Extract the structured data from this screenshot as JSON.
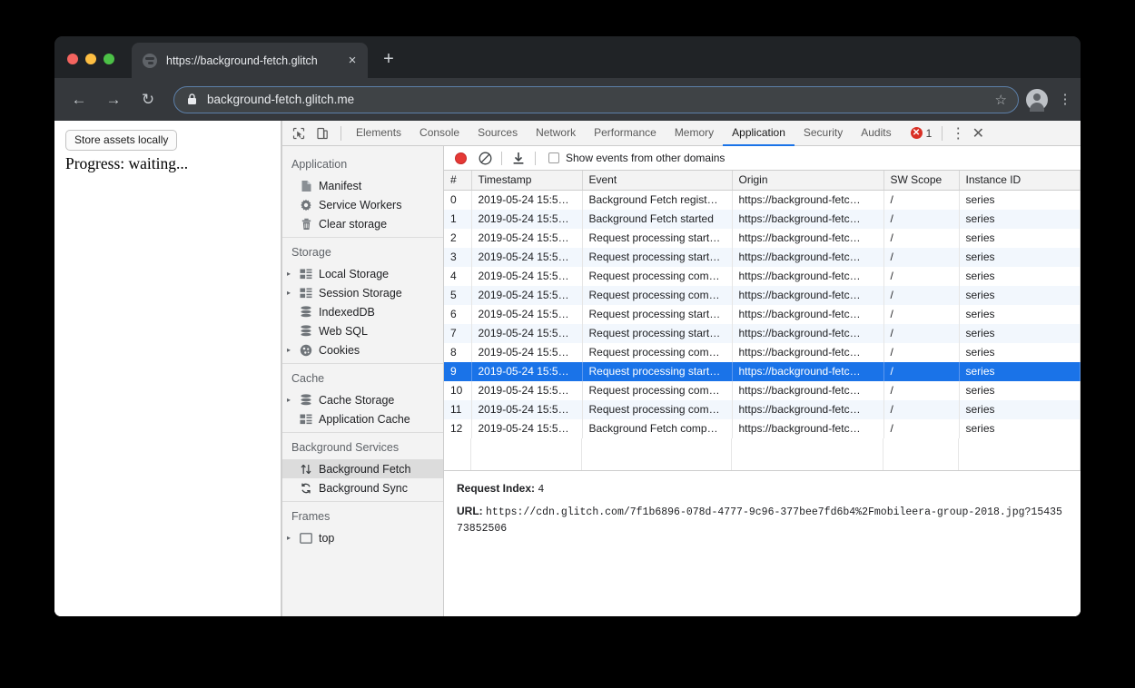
{
  "browser": {
    "tab": {
      "title": "https://background-fetch.glitch",
      "close_label": "×",
      "new_tab_label": "+"
    },
    "nav": {
      "back": "←",
      "forward": "→",
      "reload": "↻"
    },
    "omnibox": {
      "url": "background-fetch.glitch.me",
      "star": "☆"
    },
    "menu": "⋮"
  },
  "page": {
    "store_button": "Store assets locally",
    "progress": "Progress: waiting..."
  },
  "devtools": {
    "tabs": [
      {
        "label": "Elements",
        "active": false
      },
      {
        "label": "Console",
        "active": false
      },
      {
        "label": "Sources",
        "active": false
      },
      {
        "label": "Network",
        "active": false
      },
      {
        "label": "Performance",
        "active": false
      },
      {
        "label": "Memory",
        "active": false
      },
      {
        "label": "Application",
        "active": true
      },
      {
        "label": "Security",
        "active": false
      },
      {
        "label": "Audits",
        "active": false
      }
    ],
    "error_count": "1",
    "more_label": "⋮",
    "close_label": "✕",
    "sidebar": [
      {
        "title": "Application",
        "items": [
          {
            "label": "Manifest",
            "icon": "document-icon",
            "expandable": false,
            "selected": false
          },
          {
            "label": "Service Workers",
            "icon": "gear-icon",
            "expandable": false,
            "selected": false
          },
          {
            "label": "Clear storage",
            "icon": "trash-icon",
            "expandable": false,
            "selected": false
          }
        ]
      },
      {
        "title": "Storage",
        "items": [
          {
            "label": "Local Storage",
            "icon": "table-icon",
            "expandable": true,
            "selected": false
          },
          {
            "label": "Session Storage",
            "icon": "table-icon",
            "expandable": true,
            "selected": false
          },
          {
            "label": "IndexedDB",
            "icon": "database-icon",
            "expandable": false,
            "selected": false
          },
          {
            "label": "Web SQL",
            "icon": "database-icon",
            "expandable": false,
            "selected": false
          },
          {
            "label": "Cookies",
            "icon": "cookie-icon",
            "expandable": true,
            "selected": false
          }
        ]
      },
      {
        "title": "Cache",
        "items": [
          {
            "label": "Cache Storage",
            "icon": "database-icon",
            "expandable": true,
            "selected": false
          },
          {
            "label": "Application Cache",
            "icon": "table-icon",
            "expandable": false,
            "selected": false
          }
        ]
      },
      {
        "title": "Background Services",
        "items": [
          {
            "label": "Background Fetch",
            "icon": "updown-arrows-icon",
            "expandable": false,
            "selected": true
          },
          {
            "label": "Background Sync",
            "icon": "refresh-icon",
            "expandable": false,
            "selected": false
          }
        ]
      },
      {
        "title": "Frames",
        "items": [
          {
            "label": "top",
            "icon": "frame-icon",
            "expandable": true,
            "selected": false
          }
        ]
      }
    ],
    "panel_toolbar": {
      "record_label": "record-button",
      "clear_label": "clear-button",
      "export_label": "export-button",
      "checkbox_label": "Show events from other domains",
      "checkbox_checked": false
    },
    "table": {
      "columns": [
        "#",
        "Timestamp",
        "Event",
        "Origin",
        "SW Scope",
        "Instance ID"
      ],
      "rows": [
        {
          "num": "0",
          "timestamp": "2019-05-24 15:5…",
          "event": "Background Fetch regist…",
          "origin": "https://background-fetc…",
          "scope": "/",
          "instance": "series",
          "selected": false
        },
        {
          "num": "1",
          "timestamp": "2019-05-24 15:5…",
          "event": "Background Fetch started",
          "origin": "https://background-fetc…",
          "scope": "/",
          "instance": "series",
          "selected": false
        },
        {
          "num": "2",
          "timestamp": "2019-05-24 15:5…",
          "event": "Request processing start…",
          "origin": "https://background-fetc…",
          "scope": "/",
          "instance": "series",
          "selected": false
        },
        {
          "num": "3",
          "timestamp": "2019-05-24 15:5…",
          "event": "Request processing start…",
          "origin": "https://background-fetc…",
          "scope": "/",
          "instance": "series",
          "selected": false
        },
        {
          "num": "4",
          "timestamp": "2019-05-24 15:5…",
          "event": "Request processing com…",
          "origin": "https://background-fetc…",
          "scope": "/",
          "instance": "series",
          "selected": false
        },
        {
          "num": "5",
          "timestamp": "2019-05-24 15:5…",
          "event": "Request processing com…",
          "origin": "https://background-fetc…",
          "scope": "/",
          "instance": "series",
          "selected": false
        },
        {
          "num": "6",
          "timestamp": "2019-05-24 15:5…",
          "event": "Request processing start…",
          "origin": "https://background-fetc…",
          "scope": "/",
          "instance": "series",
          "selected": false
        },
        {
          "num": "7",
          "timestamp": "2019-05-24 15:5…",
          "event": "Request processing start…",
          "origin": "https://background-fetc…",
          "scope": "/",
          "instance": "series",
          "selected": false
        },
        {
          "num": "8",
          "timestamp": "2019-05-24 15:5…",
          "event": "Request processing com…",
          "origin": "https://background-fetc…",
          "scope": "/",
          "instance": "series",
          "selected": false
        },
        {
          "num": "9",
          "timestamp": "2019-05-24 15:5…",
          "event": "Request processing start…",
          "origin": "https://background-fetc…",
          "scope": "/",
          "instance": "series",
          "selected": true
        },
        {
          "num": "10",
          "timestamp": "2019-05-24 15:5…",
          "event": "Request processing com…",
          "origin": "https://background-fetc…",
          "scope": "/",
          "instance": "series",
          "selected": false
        },
        {
          "num": "11",
          "timestamp": "2019-05-24 15:5…",
          "event": "Request processing com…",
          "origin": "https://background-fetc…",
          "scope": "/",
          "instance": "series",
          "selected": false
        },
        {
          "num": "12",
          "timestamp": "2019-05-24 15:5…",
          "event": "Background Fetch comp…",
          "origin": "https://background-fetc…",
          "scope": "/",
          "instance": "series",
          "selected": false
        }
      ]
    },
    "detail": {
      "request_index_key": "Request Index:",
      "request_index_value": "4",
      "url_key": "URL:",
      "url_value": "https://cdn.glitch.com/7f1b6896-078d-4777-9c96-377bee7fd6b4%2Fmobileera-group-2018.jpg?1543573852506"
    }
  },
  "colors": {
    "accent": "#1a73e8",
    "error": "#d93025",
    "tabstrip": "#202326",
    "toolbar": "#35383c",
    "sidebar_bg": "#f3f3f3"
  }
}
